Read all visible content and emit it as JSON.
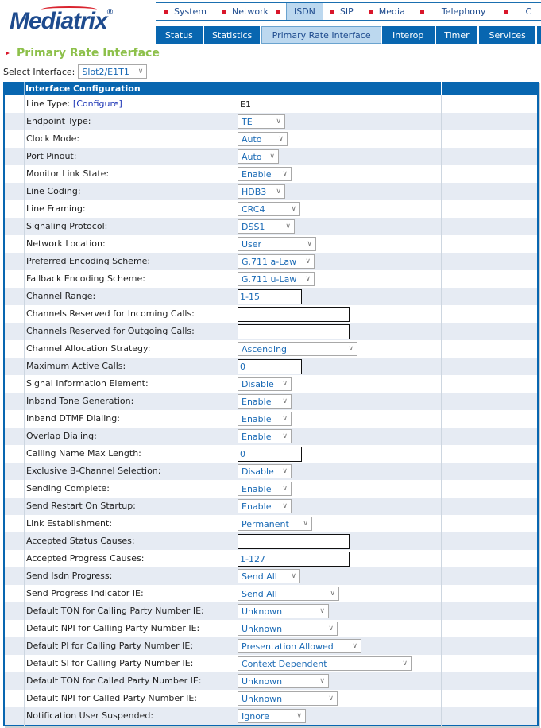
{
  "brand": {
    "logo_text": "Mediatrix",
    "registered": "®"
  },
  "top_nav": [
    {
      "label": "System",
      "active": false
    },
    {
      "label": "Network",
      "active": false
    },
    {
      "label": "ISDN",
      "active": true
    },
    {
      "label": "SIP",
      "active": false
    },
    {
      "label": "Media",
      "active": false
    },
    {
      "label": "Telephony",
      "active": false
    },
    {
      "label": "C",
      "active": false
    }
  ],
  "sub_nav": [
    {
      "label": "Status",
      "active": false
    },
    {
      "label": "Statistics",
      "active": false
    },
    {
      "label": "Primary Rate Interface",
      "active": true
    },
    {
      "label": "Interop",
      "active": false
    },
    {
      "label": "Timer",
      "active": false
    },
    {
      "label": "Services",
      "active": false
    }
  ],
  "page": {
    "title": "Primary Rate Interface",
    "select_interface_label": "Select Interface:",
    "select_interface_value": "Slot2/E1T1"
  },
  "panel": {
    "title": "Interface Configuration",
    "rows": [
      {
        "label": "Line Type:",
        "link": "[Configure]",
        "type": "static",
        "value": "E1"
      },
      {
        "label": "Endpoint Type:",
        "type": "select",
        "value": "TE"
      },
      {
        "label": "Clock Mode:",
        "type": "select",
        "value": "Auto"
      },
      {
        "label": "Port Pinout:",
        "type": "select",
        "value": "Auto"
      },
      {
        "label": "Monitor Link State:",
        "type": "select",
        "value": "Enable"
      },
      {
        "label": "Line Coding:",
        "type": "select",
        "value": "HDB3"
      },
      {
        "label": "Line Framing:",
        "type": "select",
        "value": "CRC4"
      },
      {
        "label": "Signaling Protocol:",
        "type": "select",
        "value": "DSS1"
      },
      {
        "label": "Network Location:",
        "type": "select",
        "value": "User"
      },
      {
        "label": "Preferred Encoding Scheme:",
        "type": "select",
        "value": "G.711 a-Law"
      },
      {
        "label": "Fallback Encoding Scheme:",
        "type": "select",
        "value": "G.711 u-Law"
      },
      {
        "label": "Channel Range:",
        "type": "text",
        "value": "1-15"
      },
      {
        "label": "Channels Reserved for Incoming Calls:",
        "type": "text",
        "value": ""
      },
      {
        "label": "Channels Reserved for Outgoing Calls:",
        "type": "text",
        "value": ""
      },
      {
        "label": "Channel Allocation Strategy:",
        "type": "select",
        "value": "Ascending"
      },
      {
        "label": "Maximum Active Calls:",
        "type": "text",
        "value": "0"
      },
      {
        "label": "Signal Information Element:",
        "type": "select",
        "value": "Disable"
      },
      {
        "label": "Inband Tone Generation:",
        "type": "select",
        "value": "Enable"
      },
      {
        "label": "Inband DTMF Dialing:",
        "type": "select",
        "value": "Enable"
      },
      {
        "label": "Overlap Dialing:",
        "type": "select",
        "value": "Enable"
      },
      {
        "label": "Calling Name Max Length:",
        "type": "text",
        "value": "0"
      },
      {
        "label": "Exclusive B-Channel Selection:",
        "type": "select",
        "value": "Disable"
      },
      {
        "label": "Sending Complete:",
        "type": "select",
        "value": "Enable"
      },
      {
        "label": "Send Restart On Startup:",
        "type": "select",
        "value": "Enable"
      },
      {
        "label": "Link Establishment:",
        "type": "select",
        "value": "Permanent"
      },
      {
        "label": "Accepted Status Causes:",
        "type": "text",
        "value": ""
      },
      {
        "label": "Accepted Progress Causes:",
        "type": "text",
        "value": "1-127"
      },
      {
        "label": "Send Isdn Progress:",
        "type": "select",
        "value": "Send All"
      },
      {
        "label": "Send Progress Indicator IE:",
        "type": "select",
        "value": "Send All"
      },
      {
        "label": "Default TON for Calling Party Number IE:",
        "type": "select",
        "value": "Unknown"
      },
      {
        "label": "Default NPI for Calling Party Number IE:",
        "type": "select",
        "value": "Unknown"
      },
      {
        "label": "Default PI for Calling Party Number IE:",
        "type": "select",
        "value": "Presentation Allowed"
      },
      {
        "label": "Default SI for Calling Party Number IE:",
        "type": "select",
        "value": "Context Dependent"
      },
      {
        "label": "Default TON for Called Party Number IE:",
        "type": "select",
        "value": "Unknown"
      },
      {
        "label": "Default NPI for Called Party Number IE:",
        "type": "select",
        "value": "Unknown"
      },
      {
        "label": "Notification User Suspended:",
        "type": "select",
        "value": "Ignore"
      }
    ]
  },
  "colors": {
    "brand_blue": "#0866b0",
    "active_tab": "#bcd8ef",
    "title_green": "#8dc04a",
    "bullet_red": "#d9162a",
    "alt_row": "#e6ebf3",
    "value_blue": "#1a6ab5"
  }
}
